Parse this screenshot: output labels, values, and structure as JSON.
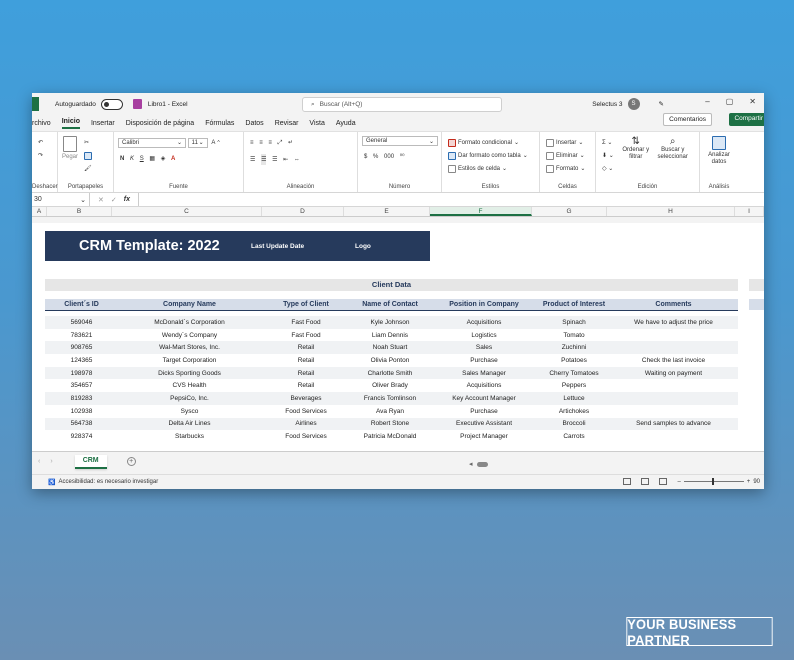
{
  "titlebar": {
    "autosave": "Autoguardado",
    "doc_title": "Libro1 - Excel",
    "search_placeholder": "Buscar (Alt+Q)",
    "user": "Selectus 3",
    "avatar": "S"
  },
  "menu": {
    "items": [
      "rchivo",
      "Inicio",
      "Insertar",
      "Disposición de página",
      "Fórmulas",
      "Datos",
      "Revisar",
      "Vista",
      "Ayuda"
    ],
    "comments": "Comentarios",
    "share": "Compartir"
  },
  "ribbon": {
    "undo_label": "Deshacer",
    "paste": "Pegar",
    "clipboard": "Portapapeles",
    "font_name": "Calibri",
    "font_size": "11",
    "bold": "N",
    "italic": "K",
    "underline": "S",
    "font_group": "Fuente",
    "align_group": "Alineación",
    "number_format": "General",
    "number_group": "Número",
    "cond_format": "Formato condicional",
    "table_format": "Dar formato como tabla",
    "cell_styles": "Estilos de celda",
    "styles_group": "Estilos",
    "insert": "Insertar",
    "delete": "Eliminar",
    "format": "Formato",
    "cells_group": "Celdas",
    "sort": "Ordenar y filtrar",
    "find": "Buscar y seleccionar",
    "edit_group": "Edición",
    "analyze": "Analizar datos",
    "analysis_group": "Análisis"
  },
  "formula": {
    "namebox": "30",
    "fx": "fx"
  },
  "columns": [
    "A",
    "B",
    "C",
    "D",
    "E",
    "F",
    "G",
    "H",
    "I"
  ],
  "sheet": {
    "banner_title": "CRM Template: 2022",
    "last_update": "Last Update Date",
    "logo": "Logo",
    "section": "Client Data",
    "headers": [
      "Client´s ID",
      "Company Name",
      "Type of Client",
      "Name of Contact",
      "Position in Company",
      "Product of Interest",
      "Comments"
    ],
    "rows": [
      [
        "569046",
        "McDonald´s Corporation",
        "Fast Food",
        "Kyle Johnson",
        "Acquisitions",
        "Spinach",
        "We have to adjust the price"
      ],
      [
        "783621",
        "Wendy´s Company",
        "Fast Food",
        "Liam Dennis",
        "Logistics",
        "Tomato",
        ""
      ],
      [
        "908765",
        "Wal-Mart Stores, Inc.",
        "Retail",
        "Noah Stuart",
        "Sales",
        "Zuchinni",
        ""
      ],
      [
        "124365",
        "Target Corporation",
        "Retail",
        "Olivia Ponton",
        "Purchase",
        "Potatoes",
        "Check the last invoice"
      ],
      [
        "198978",
        "Dicks Sporting Goods",
        "Retail",
        "Charlotte Smith",
        "Sales Manager",
        "Cherry Tomatoes",
        "Waiting on payment"
      ],
      [
        "354657",
        "CVS Health",
        "Retail",
        "Oliver Brady",
        "Acquisitions",
        "Peppers",
        ""
      ],
      [
        "819283",
        "PepsiCo, Inc.",
        "Beverages",
        "Francis Tomlinson",
        "Key Account Manager",
        "Lettuce",
        ""
      ],
      [
        "102938",
        "Sysco",
        "Food Services",
        "Ava Ryan",
        "Purchase",
        "Artichokes",
        ""
      ],
      [
        "564738",
        "Delta Air Lines",
        "Airlines",
        "Robert Stone",
        "Executive Assistant",
        "Broccoli",
        "Send samples to advance"
      ],
      [
        "928374",
        "Starbucks",
        "Food Services",
        "Patricia McDonald",
        "Project Manager",
        "Carrots",
        ""
      ]
    ]
  },
  "tabs": {
    "sheet_name": "CRM"
  },
  "status": {
    "accessibility": "Accesibilidad: es necesario investigar",
    "zoom": "90"
  },
  "watermark": "YOUR BUSINESS PARTNER"
}
